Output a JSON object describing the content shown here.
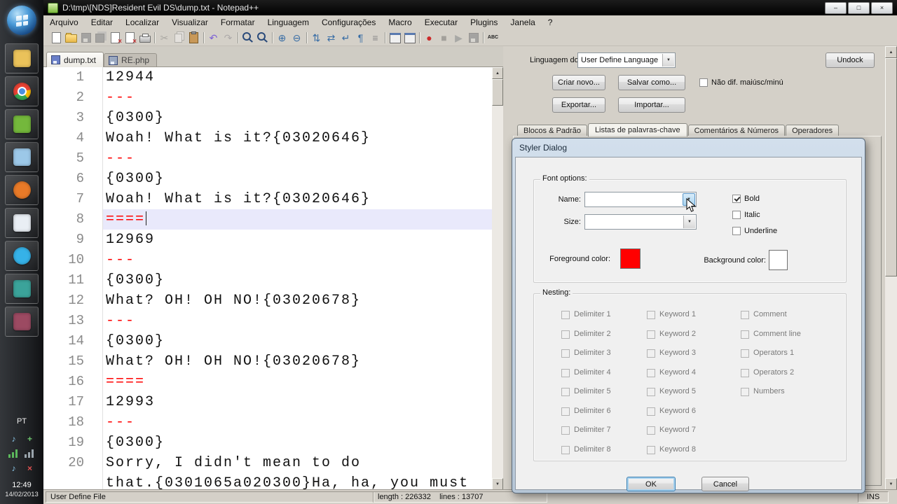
{
  "taskbar": {
    "language_indicator": "PT",
    "time": "12:49",
    "date": "14/02/2013",
    "apps": [
      {
        "name": "start-button",
        "kind": "orb"
      },
      {
        "name": "taskbar-explorer-button",
        "icon": "explorer-folder-icon",
        "kind": "swatch",
        "color": "#eac25a"
      },
      {
        "name": "taskbar-chrome-button",
        "icon": "chrome-icon",
        "kind": "chrome"
      },
      {
        "name": "taskbar-green-app-button",
        "icon": "green-app-icon",
        "kind": "swatch",
        "color": "#74b83c"
      },
      {
        "name": "taskbar-blue-app-button",
        "icon": "blue-app-icon",
        "kind": "swatch",
        "color": "#9cc8e8"
      },
      {
        "name": "taskbar-firefox-button",
        "icon": "firefox-icon",
        "kind": "swatch-round",
        "color": "#e87a28"
      },
      {
        "name": "taskbar-white-app-button",
        "icon": "white-app-icon",
        "kind": "swatch",
        "color": "#e9eef4"
      },
      {
        "name": "taskbar-skype-button",
        "icon": "skype-icon",
        "kind": "swatch-round",
        "color": "#36b2e8"
      },
      {
        "name": "taskbar-teal-app-button",
        "icon": "teal-app-icon",
        "kind": "swatch",
        "color": "#3ba39a"
      },
      {
        "name": "taskbar-camera-app-button",
        "icon": "camera-app-icon",
        "kind": "swatch",
        "color": "#9c4a62"
      }
    ],
    "tray": [
      {
        "name": "volume-icon",
        "glyph": "♪",
        "color": "#8cc8ea"
      },
      {
        "name": "update-icon",
        "glyph": "+",
        "color": "#6cc06c"
      },
      {
        "name": "network-icon",
        "kind": "bars",
        "color": "#5cb85c"
      },
      {
        "name": "signal-icon",
        "kind": "bars",
        "color": "#9aa4ac"
      },
      {
        "name": "speaker-icon",
        "glyph": "♪",
        "color": "#8cc8ea"
      },
      {
        "name": "mute-error-icon",
        "glyph": "×",
        "color": "#e05050"
      }
    ]
  },
  "window": {
    "title": "D:\\tmp\\[NDS]Resident Evil DS\\dump.txt - Notepad++",
    "controls": {
      "minimize": "–",
      "maximize": "□",
      "close": "×"
    },
    "menu": [
      "Arquivo",
      "Editar",
      "Localizar",
      "Visualizar",
      "Formatar",
      "Linguagem",
      "Configurações",
      "Macro",
      "Executar",
      "Plugins",
      "Janela",
      "?"
    ],
    "tabs": [
      {
        "label": "dump.txt"
      },
      {
        "label": "RE.php"
      }
    ]
  },
  "toolbar": {
    "icons": [
      {
        "name": "new-file-icon",
        "shape": "page"
      },
      {
        "name": "open-folder-icon",
        "shape": "folder"
      },
      {
        "name": "save-icon",
        "shape": "floppy",
        "disabled": true
      },
      {
        "name": "save-all-icon",
        "shape": "floppy2",
        "disabled": true
      },
      {
        "name": "close-file-icon",
        "shape": "pagex"
      },
      {
        "name": "close-all-icon",
        "shape": "pagex"
      },
      {
        "name": "print-icon",
        "shape": "printer"
      },
      {
        "sep": true
      },
      {
        "name": "cut-icon",
        "glyph": "✂",
        "color": "#666666",
        "disabled": true
      },
      {
        "name": "copy-icon",
        "shape": "copy",
        "disabled": true
      },
      {
        "name": "paste-icon",
        "shape": "paste"
      },
      {
        "sep": true
      },
      {
        "name": "undo-icon",
        "glyph": "↶",
        "color": "#7b5fd6"
      },
      {
        "name": "redo-icon",
        "glyph": "↷",
        "color": "#7b5fd6",
        "disabled": true
      },
      {
        "sep": true
      },
      {
        "name": "find-icon",
        "shape": "lens"
      },
      {
        "name": "replace-icon",
        "shape": "lens"
      },
      {
        "sep": true
      },
      {
        "name": "zoom-in-icon",
        "glyph": "⊕",
        "color": "#3a6ea5"
      },
      {
        "name": "zoom-out-icon",
        "glyph": "⊖",
        "color": "#3a6ea5"
      },
      {
        "sep": true
      },
      {
        "name": "sync-vertical-icon",
        "glyph": "⇅",
        "color": "#3a6ea5"
      },
      {
        "name": "sync-horizontal-icon",
        "glyph": "⇄",
        "color": "#3a6ea5"
      },
      {
        "name": "word-wrap-icon",
        "glyph": "↵",
        "color": "#3a6ea5"
      },
      {
        "name": "show-all-chars-icon",
        "glyph": "¶",
        "color": "#3a6ea5"
      },
      {
        "name": "indent-guide-icon",
        "glyph": "≡",
        "color": "#888888"
      },
      {
        "sep": true
      },
      {
        "name": "udl-dialog-icon",
        "shape": "window"
      },
      {
        "name": "doc-switcher-icon",
        "shape": "window"
      },
      {
        "sep": true
      },
      {
        "name": "record-macro-icon",
        "glyph": "●",
        "color": "#cc2a2a"
      },
      {
        "name": "stop-macro-icon",
        "glyph": "■",
        "color": "#555555",
        "disabled": true
      },
      {
        "name": "play-macro-icon",
        "glyph": "▶",
        "color": "#3a6ea5",
        "disabled": true
      },
      {
        "name": "save-macro-icon",
        "shape": "floppy",
        "disabled": true
      },
      {
        "sep": true
      },
      {
        "name": "spell-check-icon",
        "glyph": "ABC",
        "color": "#222222",
        "small": true
      }
    ]
  },
  "editor": {
    "lines": [
      {
        "n": "1",
        "text": "12944"
      },
      {
        "n": "2",
        "text": "---",
        "red": true
      },
      {
        "n": "3",
        "text": "{0300}"
      },
      {
        "n": "4",
        "text": "Woah! What is it?{03020646}"
      },
      {
        "n": "5",
        "text": "---",
        "red": true
      },
      {
        "n": "6",
        "text": "{0300}"
      },
      {
        "n": "7",
        "text": "Woah! What is it?{03020646}"
      },
      {
        "n": "8",
        "text": "====",
        "red": true,
        "current": true
      },
      {
        "n": "9",
        "text": "12969"
      },
      {
        "n": "10",
        "text": "---",
        "red": true
      },
      {
        "n": "11",
        "text": "{0300}"
      },
      {
        "n": "12",
        "text": "What? OH! OH NO!{03020678}"
      },
      {
        "n": "13",
        "text": "---",
        "red": true
      },
      {
        "n": "14",
        "text": "{0300}"
      },
      {
        "n": "15",
        "text": "What? OH! OH NO!{03020678}"
      },
      {
        "n": "16",
        "text": "====",
        "red": true
      },
      {
        "n": "17",
        "text": "12993"
      },
      {
        "n": "18",
        "text": "---",
        "red": true
      },
      {
        "n": "19",
        "text": "{0300}"
      },
      {
        "n": "20",
        "text": "Sorry, I didn't mean to do"
      },
      {
        "n": "",
        "text": "that.{0301065a020300}Ha, ha, you must"
      }
    ]
  },
  "udl_panel": {
    "language_label": "Linguagem do",
    "language_value": "User Define Language",
    "undock_label": "Undock",
    "create_label": "Criar novo...",
    "save_as_label": "Salvar como...",
    "case_label": "Não dif. maiúsc/minú",
    "export_label": "Exportar...",
    "import_label": "Importar...",
    "tabs": [
      "Blocos & Padrão",
      "Listas de palavras-chave",
      "Comentários & Números",
      "Operadores"
    ]
  },
  "styler": {
    "title": "Styler Dialog",
    "font_options_label": "Font options:",
    "name_label": "Name:",
    "size_label": "Size:",
    "bold_label": "Bold",
    "italic_label": "Italic",
    "underline_label": "Underline",
    "foreground_label": "Foreground color:",
    "background_label": "Background color:",
    "foreground_color": "#ff0000",
    "background_color": "#ffffff",
    "nesting_label": "Nesting:",
    "delimiters": [
      "Delimiter 1",
      "Delimiter 2",
      "Delimiter 3",
      "Delimiter 4",
      "Delimiter 5",
      "Delimiter 6",
      "Delimiter 7",
      "Delimiter 8"
    ],
    "keywords": [
      "Keyword 1",
      "Keyword 2",
      "Keyword 3",
      "Keyword 4",
      "Keyword 5",
      "Keyword 6",
      "Keyword 7",
      "Keyword 8"
    ],
    "others": [
      "Comment",
      "Comment line",
      "Operators 1",
      "Operators 2",
      "Numbers"
    ],
    "ok_label": "OK",
    "cancel_label": "Cancel"
  },
  "status_bar": {
    "doc_type": "User Define File",
    "length_info": "length : 226332    lines : 13707",
    "ins_label": "INS"
  }
}
